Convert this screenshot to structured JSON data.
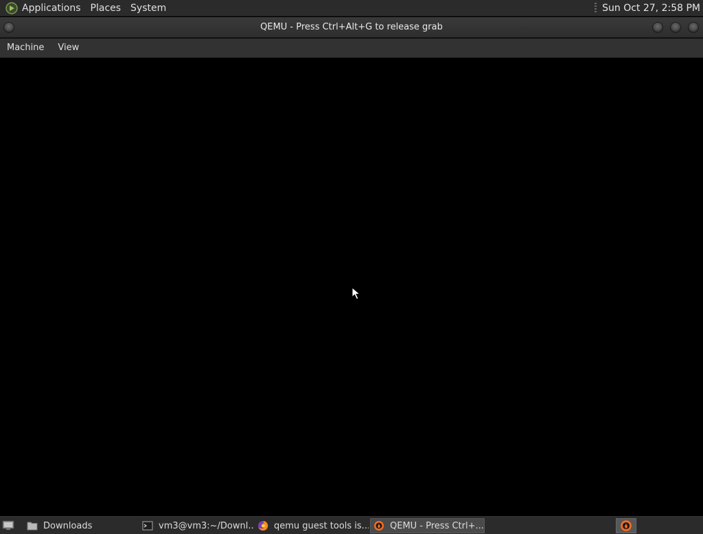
{
  "top_panel": {
    "menus": [
      "Applications",
      "Places",
      "System"
    ],
    "clock": "Sun Oct 27,  2:58 PM"
  },
  "window": {
    "title": "QEMU - Press Ctrl+Alt+G to release grab"
  },
  "menubar": {
    "items": [
      "Machine",
      "View"
    ]
  },
  "taskbar": {
    "items": [
      {
        "label": "Downloads",
        "icon": "folder-icon"
      },
      {
        "label": "vm3@vm3:~/Downl...",
        "icon": "terminal-icon"
      },
      {
        "label": "qemu guest tools is...",
        "icon": "firefox-icon"
      },
      {
        "label": "QEMU - Press Ctrl+...",
        "icon": "qemu-icon",
        "active": true
      }
    ]
  }
}
